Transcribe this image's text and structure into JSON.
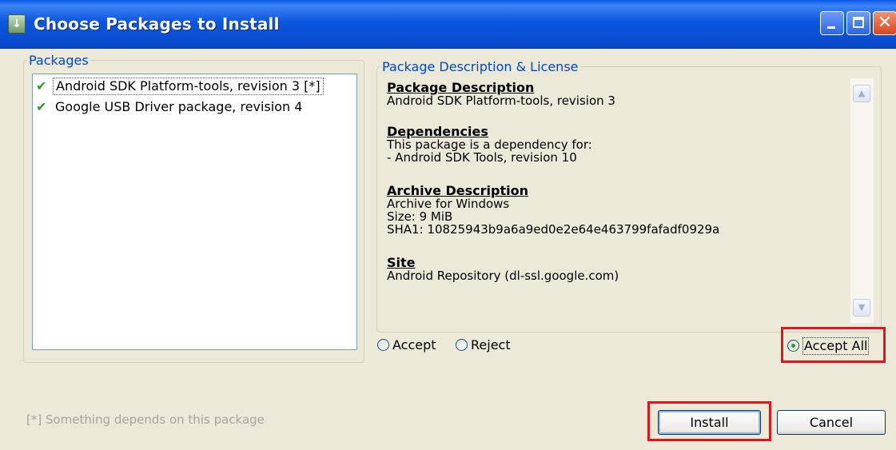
{
  "window": {
    "title": "Choose Packages to Install",
    "title_icon": "download-arrow-icon"
  },
  "packages": {
    "legend": "Packages",
    "items": [
      {
        "label": "Android SDK Platform-tools, revision 3 [*]",
        "accepted": true,
        "selected": true
      },
      {
        "label": "Google USB Driver package, revision 4",
        "accepted": true,
        "selected": false
      }
    ]
  },
  "description": {
    "legend": "Package Description & License",
    "package_heading": "Package Description",
    "package_text": "Android SDK Platform-tools, revision 3",
    "dependencies_heading": "Dependencies",
    "dependencies_line1": "This package is a dependency for:",
    "dependencies_line2": "- Android SDK Tools, revision 10",
    "archive_heading": "Archive Description",
    "archive_line1": "Archive for Windows",
    "archive_line2": "Size: 9 MiB",
    "archive_line3": "SHA1: 10825943b9a6a9ed0e2e64e463799fafadf0929a",
    "site_heading": "Site",
    "site_text": "Android Repository (dl-ssl.google.com)"
  },
  "license_choice": {
    "accept_label": "Accept",
    "reject_label": "Reject",
    "accept_all_label": "Accept All",
    "selected": "accept_all"
  },
  "footer": {
    "note": "[*] Something depends on this package",
    "install_label": "Install",
    "cancel_label": "Cancel"
  },
  "colors": {
    "titlebar": "#0a4fd3",
    "legend_text": "#0046d5",
    "check": "#2aa01a",
    "highlight": "#e0141b"
  }
}
